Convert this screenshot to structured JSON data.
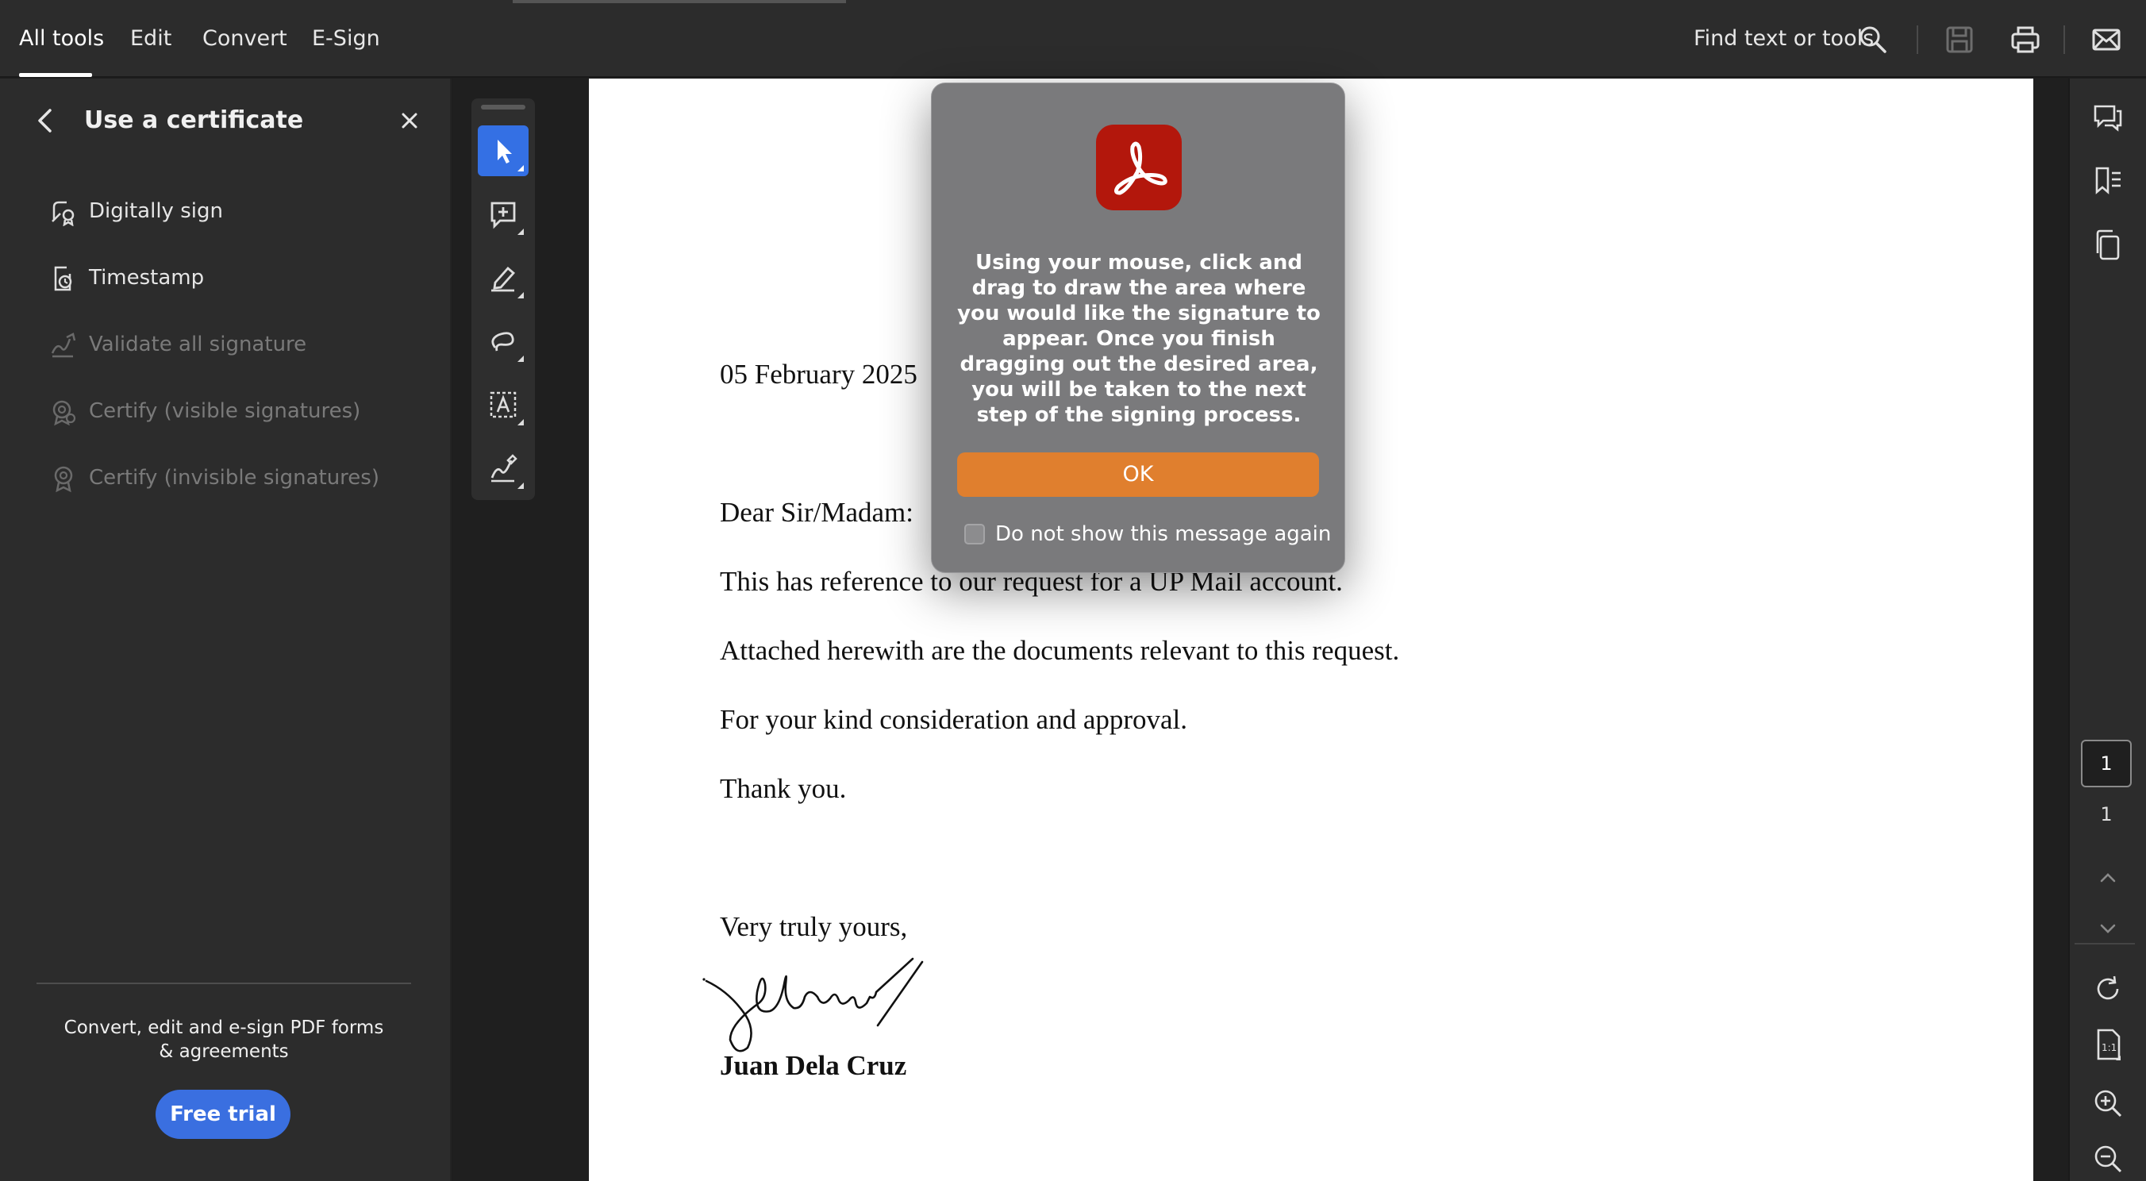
{
  "topbar": {
    "menu": [
      "All tools",
      "Edit",
      "Convert",
      "E-Sign"
    ],
    "find_label": "Find text or tools",
    "icons": [
      "search-icon",
      "save-icon",
      "print-icon",
      "mail-icon"
    ]
  },
  "panel": {
    "title": "Use a certificate",
    "items": [
      {
        "label": "Digitally sign",
        "icon": "digitally-sign-icon",
        "enabled": true
      },
      {
        "label": "Timestamp",
        "icon": "timestamp-icon",
        "enabled": true
      },
      {
        "label": "Validate all signature",
        "icon": "validate-signature-icon",
        "enabled": false
      },
      {
        "label": "Certify (visible signatures)",
        "icon": "certify-visible-icon",
        "enabled": false
      },
      {
        "label": "Certify (invisible signatures)",
        "icon": "certify-invisible-icon",
        "enabled": false
      }
    ],
    "promo": "Convert, edit and e-sign PDF forms & agreements",
    "promo_line1": "Convert, edit and e-sign PDF forms",
    "promo_line2": "& agreements",
    "free_trial": "Free trial"
  },
  "tools": [
    "select-tool-icon",
    "add-comment-icon",
    "highlight-icon",
    "draw-freehand-icon",
    "text-select-icon",
    "sign-icon"
  ],
  "document": {
    "date": "05 February 2025",
    "salutation": "Dear Sir/Madam:",
    "para1": "This has reference to our request for a UP Mail account.",
    "para2": "Attached herewith are the documents relevant to this request.",
    "para3": "For your kind consideration and approval.",
    "para4": "Thank you.",
    "closing": "Very truly yours,",
    "signatory": "Juan Dela Cruz"
  },
  "rightrail": {
    "current_page": "1",
    "total_pages": "1"
  },
  "dialog": {
    "message": "Using your mouse, click and drag to draw the area where you would like the signature to appear. Once you finish dragging out the desired area, you will be taken to the next step of the signing process.",
    "ok": "OK",
    "checkbox_label": "Do not show this message again",
    "checkbox_checked": false
  },
  "colors": {
    "accent_blue": "#3470e4",
    "ok_orange": "#e07f2e",
    "acrobat_red": "#b3170c"
  }
}
